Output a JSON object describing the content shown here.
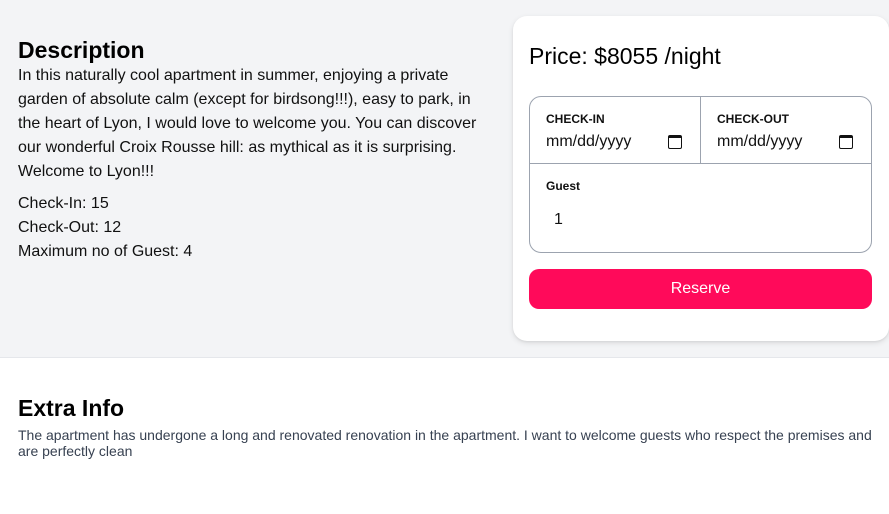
{
  "description": {
    "heading": "Description",
    "text": "In this naturally cool apartment in summer, enjoying a private garden of absolute calm (except for birdsong!!!), easy to park, in the heart of Lyon, I would love to welcome you. You can discover our wonderful Croix Rousse hill: as mythical as it is surprising. Welcome to Lyon!!!",
    "check_in": "Check-In: 15",
    "check_out": "Check-Out: 12",
    "max_guests": "Maximum no of Guest: 4"
  },
  "booking": {
    "price": "Price: $8055 /night",
    "check_in_label": "CHECK-IN",
    "check_in_value": "mm/dd/yyyy",
    "check_out_label": "CHECK-OUT",
    "check_out_value": "mm/dd/yyyy",
    "guest_label": "Guest",
    "guest_value": "1",
    "reserve_label": "Reserve"
  },
  "extra": {
    "heading": "Extra Info",
    "text": "The apartment has undergone a long and renovated renovation in the apartment. I want to welcome guests who respect the premises and are perfectly clean"
  },
  "colors": {
    "accent": "#ff0a5a",
    "top_background": "#f3f4f6"
  }
}
